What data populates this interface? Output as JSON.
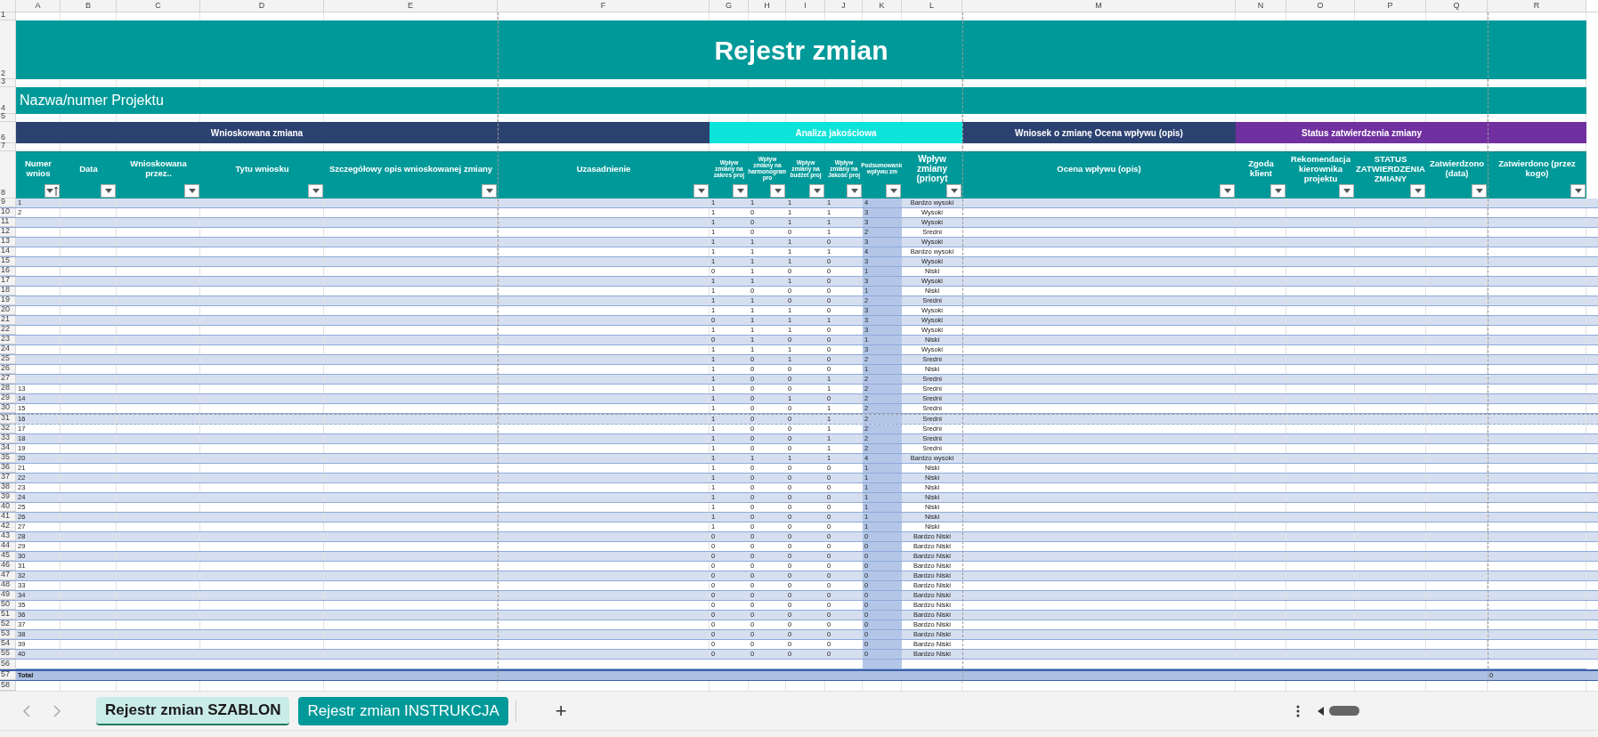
{
  "columns": [
    "A",
    "B",
    "C",
    "D",
    "E",
    "F",
    "G",
    "H",
    "I",
    "J",
    "K",
    "L",
    "M",
    "N",
    "O",
    "P",
    "Q",
    "R"
  ],
  "top_rows": [
    {
      "kind": "blank",
      "num": "1"
    },
    {
      "kind": "title",
      "num": "2",
      "text": "Rejestr zmian"
    },
    {
      "kind": "blank",
      "num": "3"
    },
    {
      "kind": "project",
      "num": "4",
      "text": "Nazwa/numer Projektu"
    },
    {
      "kind": "blank",
      "num": "5"
    },
    {
      "kind": "bands",
      "num": "6",
      "bands": [
        {
          "text": "Wnioskowana zmiana",
          "color": "#2b4170"
        },
        {
          "text": "Analiza jakościowa",
          "color": "#0ee3da"
        },
        {
          "text": "Wniosek o zmianę Ocena wpływu (opis)",
          "color": "#2b4170"
        },
        {
          "text": "Status zatwierdzenia zmiany",
          "color": "#7030a0"
        }
      ]
    },
    {
      "kind": "blank",
      "num": "7"
    }
  ],
  "header_row": {
    "num": "8",
    "headers": [
      {
        "text": "Numer wnios",
        "sorted": true
      },
      {
        "text": "Data",
        "sorted": false
      },
      {
        "text": "Wnioskowana przez..",
        "sorted": false
      },
      {
        "text": "Tytu wniosku",
        "sorted": false
      },
      {
        "text": "Szczegółowy opis wnioskowanej zmiany",
        "sorted": false
      },
      {
        "text": "Uzasadnienie",
        "sorted": false
      },
      {
        "text": "Wpływ zmiany na zakres proj",
        "sorted": false
      },
      {
        "text": "Wpływ zmiany na harmonogram pro",
        "sorted": false
      },
      {
        "text": "Wpływ zmiany na budżet proj",
        "sorted": false
      },
      {
        "text": "Wpływ zmiany na Jakość proj",
        "sorted": false
      },
      {
        "text": "Podsumowanie wpływu zm",
        "sorted": false
      },
      {
        "text": "Wpływ zmiany (prioryt",
        "sorted": false
      },
      {
        "text": "Ocena wpływu (opis)",
        "sorted": false
      },
      {
        "text": "Zgoda klient",
        "sorted": false
      },
      {
        "text": "Rekomendacja kierownika projektu",
        "sorted": false
      },
      {
        "text": "STATUS ZATWIERDZENIA ZMIANY",
        "sorted": false
      },
      {
        "text": "Zatwierdzono (data)",
        "sorted": false
      },
      {
        "text": "Zatwierdono (przez kogo)",
        "sorted": false
      }
    ]
  },
  "rows": [
    {
      "num": "9",
      "a": "1",
      "g": "1",
      "h": "1",
      "i": "1",
      "j": "1",
      "k": "4",
      "l": "Bardzo wysoki"
    },
    {
      "num": "10",
      "a": "2",
      "g": "1",
      "h": "0",
      "i": "1",
      "j": "1",
      "k": "3",
      "l": "Wysoki"
    },
    {
      "num": "11",
      "g": "1",
      "h": "0",
      "i": "1",
      "j": "1",
      "k": "3",
      "l": "Wysoki"
    },
    {
      "num": "12",
      "g": "1",
      "h": "0",
      "i": "0",
      "j": "1",
      "k": "2",
      "l": "Sredni"
    },
    {
      "num": "13",
      "g": "1",
      "h": "1",
      "i": "1",
      "j": "0",
      "k": "3",
      "l": "Wysoki"
    },
    {
      "num": "14",
      "g": "1",
      "h": "1",
      "i": "1",
      "j": "1",
      "k": "4",
      "l": "Bardzo wysoki"
    },
    {
      "num": "15",
      "g": "1",
      "h": "1",
      "i": "1",
      "j": "0",
      "k": "3",
      "l": "Wysoki"
    },
    {
      "num": "16",
      "g": "0",
      "h": "1",
      "i": "0",
      "j": "0",
      "k": "1",
      "l": "Niski"
    },
    {
      "num": "17",
      "g": "1",
      "h": "1",
      "i": "1",
      "j": "0",
      "k": "3",
      "l": "Wysoki"
    },
    {
      "num": "18",
      "g": "1",
      "h": "0",
      "i": "0",
      "j": "0",
      "k": "1",
      "l": "Niski"
    },
    {
      "num": "19",
      "g": "1",
      "h": "1",
      "i": "0",
      "j": "0",
      "k": "2",
      "l": "Sredni"
    },
    {
      "num": "20",
      "g": "1",
      "h": "1",
      "i": "1",
      "j": "0",
      "k": "3",
      "l": "Wysoki"
    },
    {
      "num": "21",
      "g": "0",
      "h": "1",
      "i": "1",
      "j": "1",
      "k": "3",
      "l": "Wysoki"
    },
    {
      "num": "22",
      "g": "1",
      "h": "1",
      "i": "1",
      "j": "0",
      "k": "3",
      "l": "Wysoki"
    },
    {
      "num": "23",
      "g": "0",
      "h": "1",
      "i": "0",
      "j": "0",
      "k": "1",
      "l": "Niski"
    },
    {
      "num": "24",
      "g": "1",
      "h": "1",
      "i": "1",
      "j": "0",
      "k": "3",
      "l": "Wysoki"
    },
    {
      "num": "25",
      "g": "1",
      "h": "0",
      "i": "1",
      "j": "0",
      "k": "2",
      "l": "Sredni"
    },
    {
      "num": "26",
      "g": "1",
      "h": "0",
      "i": "0",
      "j": "0",
      "k": "1",
      "l": "Niski"
    },
    {
      "num": "27",
      "g": "1",
      "h": "0",
      "i": "0",
      "j": "1",
      "k": "2",
      "l": "Sredni"
    },
    {
      "num": "28",
      "a": "13",
      "g": "1",
      "h": "0",
      "i": "0",
      "j": "1",
      "k": "2",
      "l": "Sredni"
    },
    {
      "num": "29",
      "a": "14",
      "g": "1",
      "h": "0",
      "i": "1",
      "j": "0",
      "k": "2",
      "l": "Sredni"
    },
    {
      "num": "30",
      "a": "15",
      "g": "1",
      "h": "0",
      "i": "0",
      "j": "1",
      "k": "2",
      "l": "Sredni"
    },
    {
      "num": "31",
      "a": "16",
      "g": "1",
      "h": "0",
      "i": "0",
      "j": "1",
      "k": "2",
      "l": "Sredni"
    },
    {
      "num": "32",
      "a": "17",
      "g": "1",
      "h": "0",
      "i": "0",
      "j": "1",
      "k": "2",
      "l": "Sredni"
    },
    {
      "num": "33",
      "a": "18",
      "g": "1",
      "h": "0",
      "i": "0",
      "j": "1",
      "k": "2",
      "l": "Sredni"
    },
    {
      "num": "34",
      "a": "19",
      "g": "1",
      "h": "0",
      "i": "0",
      "j": "1",
      "k": "2",
      "l": "Sredni"
    },
    {
      "num": "35",
      "a": "20",
      "g": "1",
      "h": "1",
      "i": "1",
      "j": "1",
      "k": "4",
      "l": "Bardzo wysoki"
    },
    {
      "num": "36",
      "a": "21",
      "g": "1",
      "h": "0",
      "i": "0",
      "j": "0",
      "k": "1",
      "l": "Niski"
    },
    {
      "num": "37",
      "a": "22",
      "g": "1",
      "h": "0",
      "i": "0",
      "j": "0",
      "k": "1",
      "l": "Niski"
    },
    {
      "num": "38",
      "a": "23",
      "g": "1",
      "h": "0",
      "i": "0",
      "j": "0",
      "k": "1",
      "l": "Niski"
    },
    {
      "num": "39",
      "a": "24",
      "g": "1",
      "h": "0",
      "i": "0",
      "j": "0",
      "k": "1",
      "l": "Niski"
    },
    {
      "num": "40",
      "a": "25",
      "g": "1",
      "h": "0",
      "i": "0",
      "j": "0",
      "k": "1",
      "l": "Niski"
    },
    {
      "num": "41",
      "a": "26",
      "g": "1",
      "h": "0",
      "i": "0",
      "j": "0",
      "k": "1",
      "l": "Niski"
    },
    {
      "num": "42",
      "a": "27",
      "g": "1",
      "h": "0",
      "i": "0",
      "j": "0",
      "k": "1",
      "l": "Niski"
    },
    {
      "num": "43",
      "a": "28",
      "g": "0",
      "h": "0",
      "i": "0",
      "j": "0",
      "k": "0",
      "l": "Bardzo Niski"
    },
    {
      "num": "44",
      "a": "29",
      "g": "0",
      "h": "0",
      "i": "0",
      "j": "0",
      "k": "0",
      "l": "Bardzo Niski"
    },
    {
      "num": "45",
      "a": "30",
      "g": "0",
      "h": "0",
      "i": "0",
      "j": "0",
      "k": "0",
      "l": "Bardzo Niski"
    },
    {
      "num": "46",
      "a": "31",
      "g": "0",
      "h": "0",
      "i": "0",
      "j": "0",
      "k": "0",
      "l": "Bardzo Niski"
    },
    {
      "num": "47",
      "a": "32",
      "g": "0",
      "h": "0",
      "i": "0",
      "j": "0",
      "k": "0",
      "l": "Bardzo Niski"
    },
    {
      "num": "48",
      "a": "33",
      "g": "0",
      "h": "0",
      "i": "0",
      "j": "0",
      "k": "0",
      "l": "Bardzo Niski"
    },
    {
      "num": "49",
      "a": "34",
      "g": "0",
      "h": "0",
      "i": "0",
      "j": "0",
      "k": "0",
      "l": "Bardzo Niski"
    },
    {
      "num": "50",
      "a": "35",
      "g": "0",
      "h": "0",
      "i": "0",
      "j": "0",
      "k": "0",
      "l": "Bardzo Niski"
    },
    {
      "num": "51",
      "a": "36",
      "g": "0",
      "h": "0",
      "i": "0",
      "j": "0",
      "k": "0",
      "l": "Bardzo Niski"
    },
    {
      "num": "52",
      "a": "37",
      "g": "0",
      "h": "0",
      "i": "0",
      "j": "0",
      "k": "0",
      "l": "Bardzo Niski"
    },
    {
      "num": "53",
      "a": "38",
      "g": "0",
      "h": "0",
      "i": "0",
      "j": "0",
      "k": "0",
      "l": "Bardzo Niski"
    },
    {
      "num": "54",
      "a": "39",
      "g": "0",
      "h": "0",
      "i": "0",
      "j": "0",
      "k": "0",
      "l": "Bardzo Niski"
    },
    {
      "num": "55",
      "a": "40",
      "g": "0",
      "h": "0",
      "i": "0",
      "j": "0",
      "k": "0",
      "l": "Bardzo Niski"
    }
  ],
  "empty_row": {
    "num": "56"
  },
  "total_row": {
    "num": "57",
    "label": "Total",
    "value": "0"
  },
  "after_rows": [
    "58"
  ],
  "sheet_tabs": [
    {
      "label": "Rejestr zmian SZABLON",
      "selected": true
    },
    {
      "label": "Rejestr zmian INSTRUKCJA",
      "selected": false
    }
  ],
  "add_sheet": "+"
}
